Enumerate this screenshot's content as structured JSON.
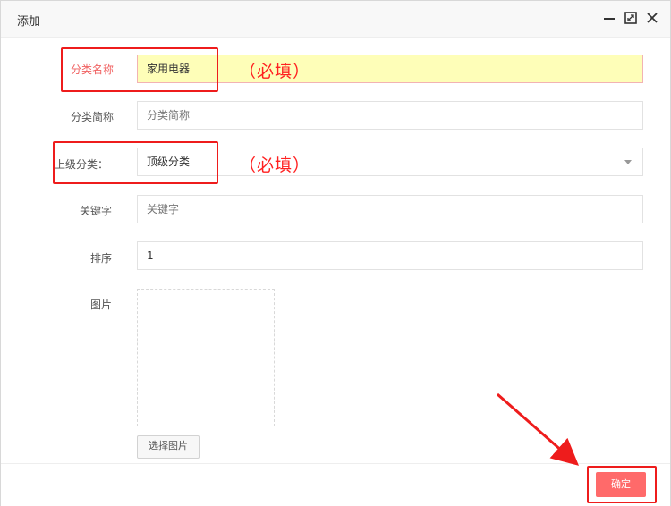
{
  "dialog": {
    "title": "添加"
  },
  "form": {
    "category_name": {
      "label": "分类名称",
      "value": "家用电器"
    },
    "category_short": {
      "label": "分类简称",
      "placeholder": "分类简称"
    },
    "parent_category": {
      "label": "上级分类：",
      "value": "顶级分类"
    },
    "keywords": {
      "label": "关键字",
      "placeholder": "关键字"
    },
    "sort": {
      "label": "排序",
      "value": "1"
    },
    "image": {
      "label": "图片",
      "button_label": "选择图片"
    }
  },
  "annotations": {
    "required_1": "（必填）",
    "required_2": "（必填）"
  },
  "footer": {
    "confirm_label": "确定"
  },
  "colors": {
    "annotation_red": "#ee1c1c",
    "confirm_button": "#ff6a6a",
    "highlight_field": "#fefeb8"
  },
  "icons": [
    "minimize-icon",
    "maximize-icon",
    "close-icon",
    "dropdown-arrow-icon"
  ]
}
